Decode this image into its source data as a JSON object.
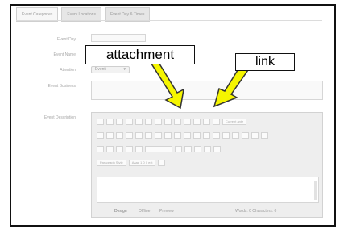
{
  "tabs": [
    "Event Categories",
    "Event Locations",
    "Event Day & Times"
  ],
  "form": {
    "labels": {
      "event_day": "Event Day",
      "event_name": "Event Name",
      "attention": "Attention",
      "event_business": "Event Business",
      "event_description": "Event Description"
    },
    "attention_value": "Event"
  },
  "editor": {
    "select_style": "Paragraph Style",
    "select_font": "Aaaa 1 0 0 ext",
    "toolbar_label": "Current ante",
    "status_tabs": [
      "Design",
      "Offline",
      "Preview"
    ],
    "status_words": "Words: 0  Characters: 0"
  },
  "callouts": {
    "attachment": "attachment",
    "link": "link"
  },
  "colors": {
    "arrow_fill": "#f5f500",
    "arrow_stroke": "#333333"
  }
}
